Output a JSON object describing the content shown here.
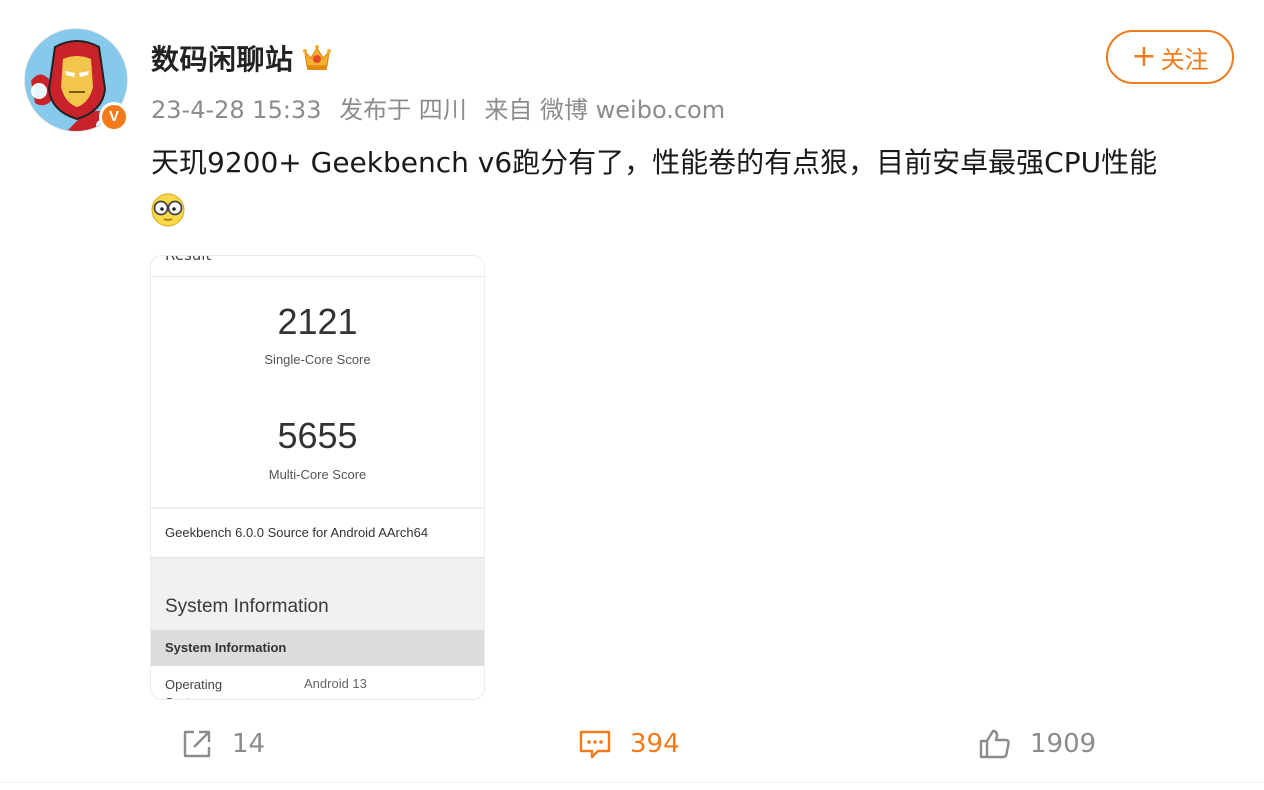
{
  "author": {
    "name": "数码闲聊站",
    "badge_icon": "crown-icon",
    "verified_mark": "V",
    "avatar_icon": "iron-man-avatar"
  },
  "meta": {
    "time": "23-4-28 15:33",
    "location": "发布于 四川",
    "source": "来自 微博 weibo.com"
  },
  "follow": {
    "plus": "+",
    "label": "关注"
  },
  "post": {
    "text": "天玑9200+ Geekbench v6跑分有了，性能卷的有点狠，目前安卓最强CPU性能",
    "emoji": "glasses-emoji-icon"
  },
  "screenshot": {
    "result_label": "Result",
    "single_core_score": "2121",
    "single_core_label": "Single-Core Score",
    "multi_core_score": "5655",
    "multi_core_label": "Multi-Core Score",
    "source_text": "Geekbench 6.0.0 Source for Android AArch64",
    "sysinfo_title": "System Information",
    "sysinfo_header": "System Information",
    "row_key": "Operating System",
    "row_value": "Android 13"
  },
  "actions": {
    "share_count": "14",
    "comment_count": "394",
    "like_count": "1909"
  },
  "colors": {
    "accent": "#f27a1a",
    "muted": "#8c8c8c"
  }
}
